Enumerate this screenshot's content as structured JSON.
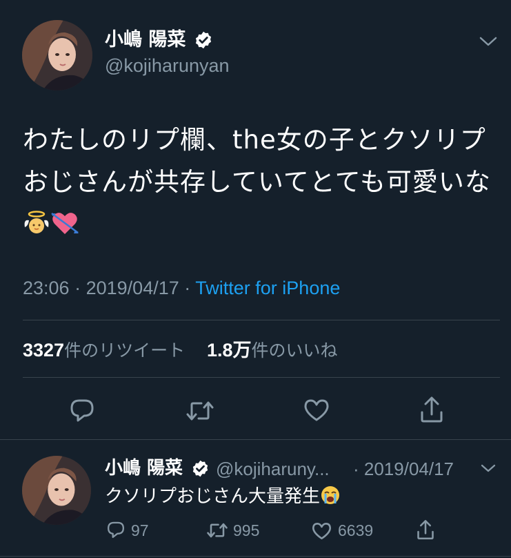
{
  "tweet": {
    "author_name": "小嶋 陽菜",
    "author_handle": "@kojiharunyan",
    "text": "わたしのリプ欄、the女の子とクソリプおじさんが共存していてとても可愛いな",
    "time": "23:06",
    "date": "2019/04/17",
    "separator": "·",
    "source": "Twitter for iPhone",
    "retweet_count": "3327",
    "retweet_label": "件のリツイート",
    "like_count": "1.8万",
    "like_label": "件のいいね"
  },
  "reply": {
    "author_name": "小嶋 陽菜",
    "author_handle": "@kojiharuny...",
    "date": "· 2019/04/17",
    "text": "クソリプおじさん大量発生",
    "reply_count": "97",
    "retweet_count": "995",
    "like_count": "6639"
  },
  "icons": {
    "verified": "verified-badge-icon",
    "chevron": "chevron-down-icon",
    "reply": "reply-icon",
    "retweet": "retweet-icon",
    "like": "heart-icon",
    "share": "share-icon",
    "emoji_angel": "baby-angel-emoji-icon",
    "emoji_heart": "heart-with-arrow-emoji-icon",
    "emoji_crying": "loudly-crying-face-emoji-icon"
  },
  "colors": {
    "background": "#15202b",
    "text": "#ffffff",
    "secondary": "#8899a6",
    "accent": "#1da1f2",
    "divider": "#38444d"
  }
}
